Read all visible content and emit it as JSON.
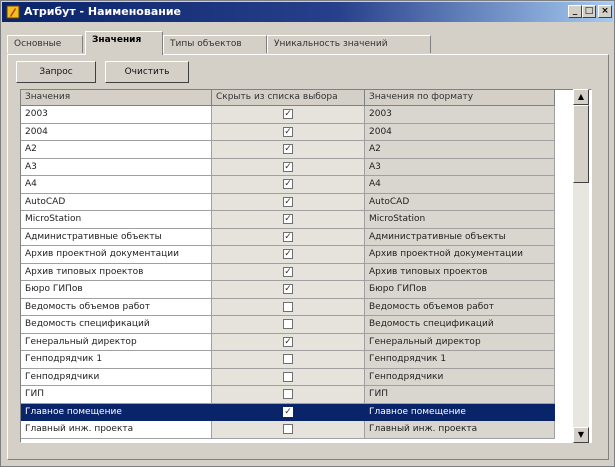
{
  "window": {
    "title": "Атрибут - Наименование",
    "minimize_label": "_",
    "maximize_label": "□",
    "close_label": "×"
  },
  "tabs": [
    {
      "label": "Основные",
      "active": false
    },
    {
      "label": "Значения",
      "active": true
    },
    {
      "label": "Типы объектов",
      "active": false
    },
    {
      "label": "Уникальность значений",
      "active": false
    }
  ],
  "toolbar": {
    "query_label": "Запрос",
    "clear_label": "Очистить"
  },
  "grid": {
    "columns": [
      "Значения",
      "Скрыть из списка выбора",
      "Значения по формату"
    ],
    "rows": [
      {
        "value": "2003",
        "hidden": true,
        "formatted": "2003"
      },
      {
        "value": "2004",
        "hidden": true,
        "formatted": "2004"
      },
      {
        "value": "A2",
        "hidden": true,
        "formatted": "A2"
      },
      {
        "value": "A3",
        "hidden": true,
        "formatted": "A3"
      },
      {
        "value": "A4",
        "hidden": true,
        "formatted": "A4"
      },
      {
        "value": "AutoCAD",
        "hidden": true,
        "formatted": "AutoCAD"
      },
      {
        "value": "MicroStation",
        "hidden": true,
        "formatted": "MicroStation"
      },
      {
        "value": "Административные объекты",
        "hidden": true,
        "formatted": "Административные объекты"
      },
      {
        "value": "Архив проектной документации",
        "hidden": true,
        "formatted": "Архив проектной документации"
      },
      {
        "value": "Архив типовых проектов",
        "hidden": true,
        "formatted": "Архив типовых проектов"
      },
      {
        "value": "Бюро ГИПов",
        "hidden": true,
        "formatted": "Бюро ГИПов"
      },
      {
        "value": "Ведомость объемов работ",
        "hidden": false,
        "formatted": "Ведомость объемов работ"
      },
      {
        "value": "Ведомость спецификаций",
        "hidden": false,
        "formatted": "Ведомость спецификаций"
      },
      {
        "value": "Генеральный директор",
        "hidden": true,
        "formatted": "Генеральный директор"
      },
      {
        "value": "Генподрядчик 1",
        "hidden": false,
        "formatted": "Генподрядчик 1"
      },
      {
        "value": "Генподрядчики",
        "hidden": false,
        "formatted": "Генподрядчики"
      },
      {
        "value": "ГИП",
        "hidden": false,
        "formatted": "ГИП"
      },
      {
        "value": "Главное помещение",
        "hidden": true,
        "formatted": "Главное помещение",
        "selected": true
      },
      {
        "value": "Главный инж. проекта",
        "hidden": false,
        "formatted": "Главный инж. проекта"
      }
    ],
    "check_glyph": "✓"
  },
  "scrollbar": {
    "up_glyph": "▲",
    "down_glyph": "▼"
  },
  "colors": {
    "titlebar": "#0a246a",
    "selection": "#0a246a",
    "face": "#d4d0c8"
  }
}
